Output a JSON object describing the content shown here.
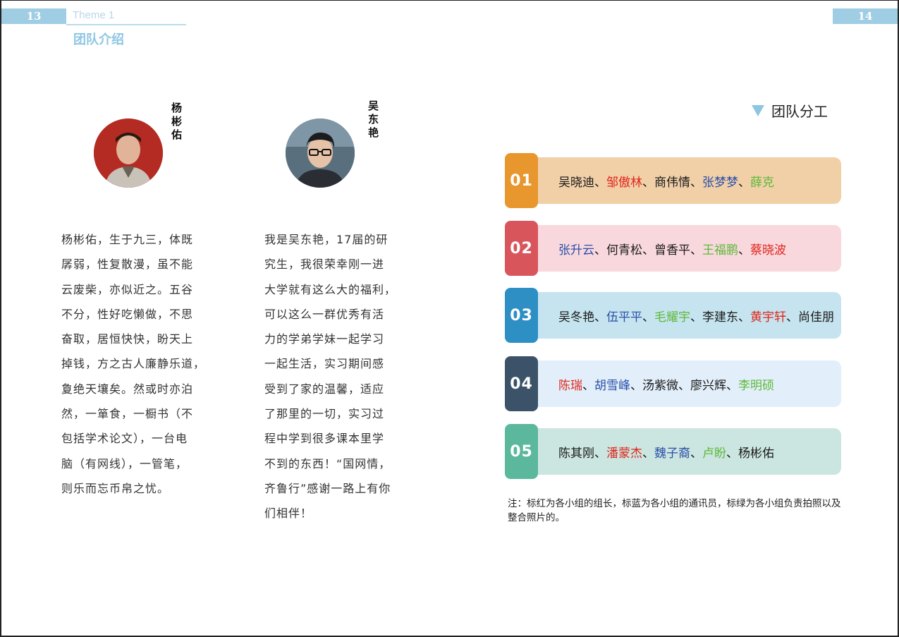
{
  "left_page": {
    "page_number": "13",
    "theme": "Theme 1",
    "section_title": "团队介绍",
    "members": [
      {
        "name": "杨彬佑",
        "bio_lines": [
          "杨彬佑，生于九三，体既",
          "孱弱，性复散漫，虽不能",
          "云废柴，亦似近之。五谷",
          "不分，性好吃懒做，不思",
          "奋取，居恒快快，盼天上",
          "掉钱，方之古人廉静乐道，",
          "夐绝天壤矣。然或时亦泊",
          "然，一箪食，一橱书（不",
          "包括学术论文），一台电",
          "脑（有网线），一管笔，",
          "则乐而忘币帛之忧。"
        ]
      },
      {
        "name": "吴东艳",
        "bio_lines": [
          "我是吴东艳，17届的研",
          "究生，我很荣幸刚一进",
          "大学就有这么大的福利，",
          "可以这么一群优秀有活",
          "力的学弟学妹一起学习",
          "一起生活，实习期间感",
          "受到了家的温馨，适应",
          "了那里的一切，实习过",
          "程中学到很多课本里学",
          "不到的东西！“国网情，",
          "齐鲁行”感谢一路上有你",
          "们相伴！"
        ]
      }
    ]
  },
  "right_page": {
    "page_number": "14",
    "division_title": "团队分工",
    "groups": [
      {
        "badge": "01",
        "badge_color": "#e8962e",
        "bar_color": "#f1d0a8",
        "members": [
          {
            "name": "吴晓迪",
            "role": "black"
          },
          {
            "name": "邹傲林",
            "role": "red"
          },
          {
            "name": "商伟情",
            "role": "black"
          },
          {
            "name": "张梦梦",
            "role": "blue"
          },
          {
            "name": "薛克",
            "role": "green"
          }
        ]
      },
      {
        "badge": "02",
        "badge_color": "#d9555c",
        "bar_color": "#f8d8dd",
        "members": [
          {
            "name": "张升云",
            "role": "blue"
          },
          {
            "name": "何青松",
            "role": "black"
          },
          {
            "name": "曾香平",
            "role": "black"
          },
          {
            "name": "王福鹏",
            "role": "green"
          },
          {
            "name": "蔡晓波",
            "role": "red"
          }
        ]
      },
      {
        "badge": "03",
        "badge_color": "#2d8fc4",
        "bar_color": "#c5e4ef",
        "members": [
          {
            "name": "吴冬艳",
            "role": "black"
          },
          {
            "name": "伍平平",
            "role": "blue"
          },
          {
            "name": "毛耀宇",
            "role": "green"
          },
          {
            "name": "李建东",
            "role": "black"
          },
          {
            "name": "黄宇轩",
            "role": "red"
          },
          {
            "name": "尚佳朋",
            "role": "black"
          }
        ]
      },
      {
        "badge": "04",
        "badge_color": "#3b5268",
        "bar_color": "#e2effa",
        "members": [
          {
            "name": "陈瑞",
            "role": "red"
          },
          {
            "name": "胡雪峰",
            "role": "blue"
          },
          {
            "name": "汤紫微",
            "role": "black"
          },
          {
            "name": "廖兴辉",
            "role": "black"
          },
          {
            "name": "李明硕",
            "role": "green"
          }
        ]
      },
      {
        "badge": "05",
        "badge_color": "#5bb89c",
        "bar_color": "#cbe6e0",
        "members": [
          {
            "name": "陈其刚",
            "role": "black"
          },
          {
            "name": "潘蒙杰",
            "role": "red"
          },
          {
            "name": "魏子裔",
            "role": "blue"
          },
          {
            "name": "卢盼",
            "role": "green"
          },
          {
            "name": "杨彬佑",
            "role": "black"
          }
        ]
      }
    ],
    "separator": "、",
    "note": "注：标红为各小组的组长，标蓝为各小组的通讯员，标绿为各小组负责拍照以及整合照片的。"
  }
}
